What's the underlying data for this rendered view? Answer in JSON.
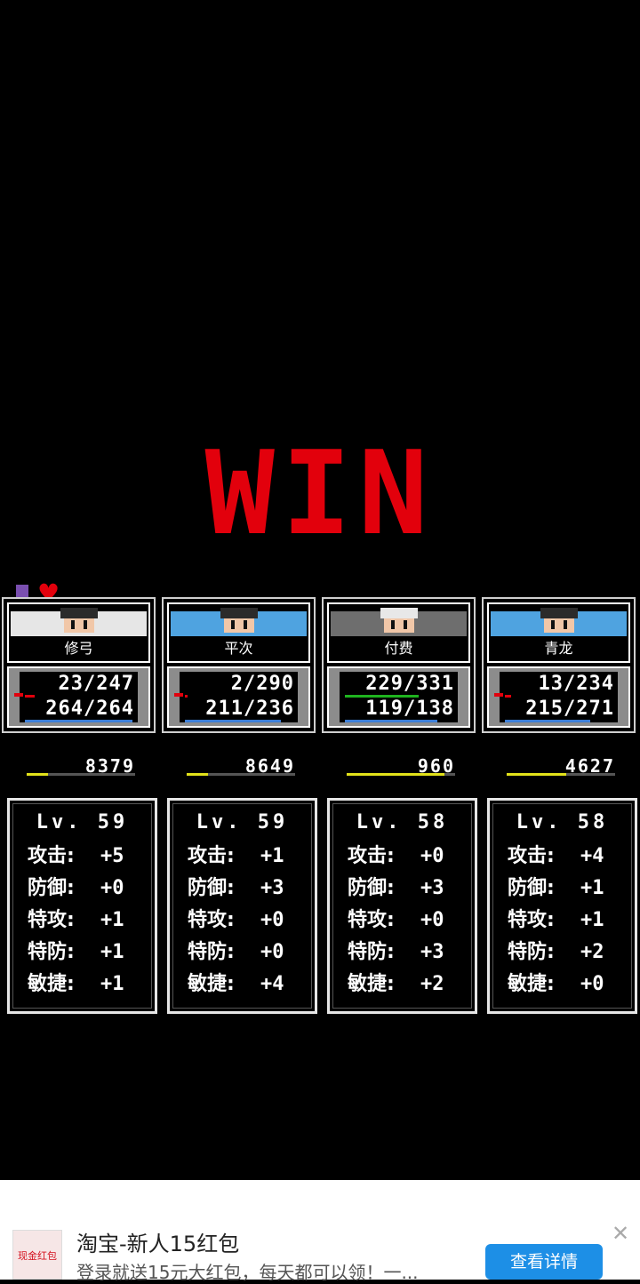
{
  "result": {
    "title": "WIN"
  },
  "party": [
    {
      "name": "修弓",
      "bar_color": "#e6e6e6",
      "hp": "23/247",
      "mp": "264/264",
      "hp_fraction": 0.09,
      "mp_fraction": 1.0,
      "hp_color": "#e2000c",
      "hair": "#2b2b2b",
      "exp": "8379",
      "exp_fraction": 0.2,
      "level": "Lv. 59",
      "stats": [
        {
          "label": "攻击:",
          "value": "+5"
        },
        {
          "label": "防御:",
          "value": "+0"
        },
        {
          "label": "特攻:",
          "value": "+1"
        },
        {
          "label": "特防:",
          "value": "+1"
        },
        {
          "label": "敏捷:",
          "value": "+1"
        }
      ]
    },
    {
      "name": "平次",
      "bar_color": "#4fa3e0",
      "hp": "2/290",
      "mp": "211/236",
      "hp_fraction": 0.01,
      "mp_fraction": 0.89,
      "hp_color": "#e2000c",
      "hair": "#2b2b2b",
      "exp": "8649",
      "exp_fraction": 0.2,
      "level": "Lv. 59",
      "stats": [
        {
          "label": "攻击:",
          "value": "+1"
        },
        {
          "label": "防御:",
          "value": "+3"
        },
        {
          "label": "特攻:",
          "value": "+0"
        },
        {
          "label": "特防:",
          "value": "+0"
        },
        {
          "label": "敏捷:",
          "value": "+4"
        }
      ]
    },
    {
      "name": "付费",
      "bar_color": "#6e6e6e",
      "hp": "229/331",
      "mp": "119/138",
      "hp_fraction": 0.69,
      "mp_fraction": 0.86,
      "hp_color": "#1fb31f",
      "hair": "#e8e8e8",
      "exp": "960",
      "exp_fraction": 0.9,
      "level": "Lv. 58",
      "stats": [
        {
          "label": "攻击:",
          "value": "+0"
        },
        {
          "label": "防御:",
          "value": "+3"
        },
        {
          "label": "特攻:",
          "value": "+0"
        },
        {
          "label": "特防:",
          "value": "+3"
        },
        {
          "label": "敏捷:",
          "value": "+2"
        }
      ]
    },
    {
      "name": "青龙",
      "bar_color": "#4fa3e0",
      "hp": "13/234",
      "mp": "215/271",
      "hp_fraction": 0.06,
      "mp_fraction": 0.79,
      "hp_color": "#e2000c",
      "hair": "#2b2b2b",
      "exp": "4627",
      "exp_fraction": 0.55,
      "level": "Lv. 58",
      "stats": [
        {
          "label": "攻击:",
          "value": "+4"
        },
        {
          "label": "防御:",
          "value": "+1"
        },
        {
          "label": "特攻:",
          "value": "+1"
        },
        {
          "label": "特防:",
          "value": "+2"
        },
        {
          "label": "敏捷:",
          "value": "+0"
        }
      ]
    }
  ],
  "ad": {
    "thumb_label": "现金红包",
    "title": "淘宝-新人15红包",
    "description": "登录就送15元大红包，每天都可以领！一...",
    "button": "查看详情",
    "close": "✕"
  }
}
